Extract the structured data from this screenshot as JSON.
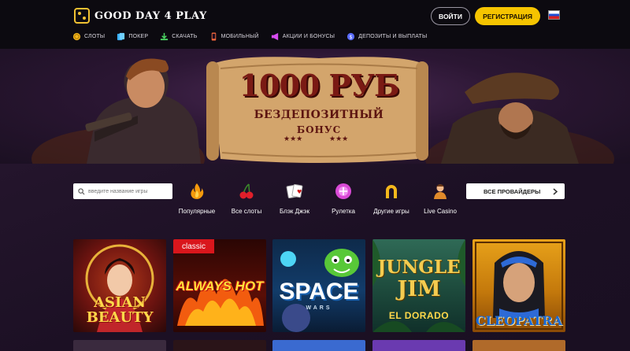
{
  "header": {
    "logo_text": "GOOD DAY 4 PLAY",
    "login_label": "ВОЙТИ",
    "register_label": "РЕГИСТРАЦИЯ",
    "language_flag": "ru-flag"
  },
  "nav": {
    "items": [
      {
        "label": "СЛОТЫ",
        "icon": "coin-icon"
      },
      {
        "label": "ПОКЕР",
        "icon": "cards-icon"
      },
      {
        "label": "СКАЧАТЬ",
        "icon": "download-icon"
      },
      {
        "label": "МОБИЛЬНЫЙ",
        "icon": "mobile-icon"
      },
      {
        "label": "АКЦИИ И БОНУСЫ",
        "icon": "megaphone-icon"
      },
      {
        "label": "ДЕПОЗИТЫ И ВЫПЛАТЫ",
        "icon": "wallet-icon"
      }
    ]
  },
  "hero": {
    "title": "1000 РУБ",
    "subtitle_line1": "БЕЗДЕПОЗИТНЫЙ",
    "subtitle_line2": "БОНУС"
  },
  "search": {
    "placeholder": "введите название игры"
  },
  "categories": [
    {
      "label": "Популярные",
      "icon": "flame-icon"
    },
    {
      "label": "Все слоты",
      "icon": "cherries-icon"
    },
    {
      "label": "Блэк Джэк",
      "icon": "playing-cards-icon"
    },
    {
      "label": "Рулетка",
      "icon": "roulette-icon"
    },
    {
      "label": "Другие игры",
      "icon": "horseshoe-icon"
    },
    {
      "label": "Live Casino",
      "icon": "dealer-icon"
    }
  ],
  "providers": {
    "label": "ВСЕ ПРОВАЙДЕРЫ"
  },
  "games": [
    {
      "title_line1": "ASIAN",
      "title_line2": "BEAUTY",
      "badge": ""
    },
    {
      "title_line1": "ALWAYS HOT",
      "title_line2": "",
      "badge": "classic"
    },
    {
      "title_line1": "SPACE",
      "title_line2": "WARS",
      "badge": ""
    },
    {
      "title_line1": "JUNGLE",
      "title_line2": "JIM",
      "subtitle": "EL DORADO",
      "badge": ""
    },
    {
      "title_line1": "CLEOPATRA",
      "title_line2": "",
      "badge": ""
    }
  ],
  "colors": {
    "accent": "#f5c400",
    "header_bg": "#0c0a10",
    "page_bg": "#1a0f22"
  }
}
